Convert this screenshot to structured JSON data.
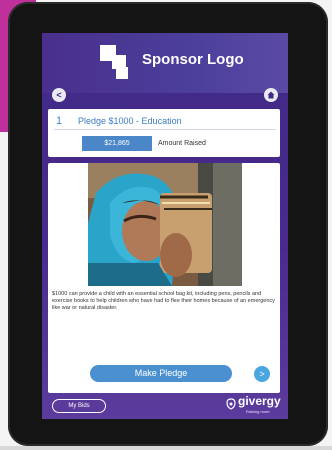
{
  "header": {
    "sponsor_logo_text": "Sponsor Logo"
  },
  "nav": {
    "back_icon": "chevron-left-icon",
    "home_icon": "home-icon"
  },
  "pledge_card": {
    "number": "1",
    "title": "Pledge $1000 - Education",
    "active_tab_label": "$21,865",
    "amount_raised_label": "Amount Raised"
  },
  "description": "$1000 can provide a child with an essential school bag kit, including pens, pencils and exercise books to help children who have had to flee their homes because of an emergency like war or natural disaster.",
  "actions": {
    "make_pledge_label": "Make Pledge",
    "next_icon": "chevron-right-icon"
  },
  "footer": {
    "my_bids_label": "My Bids",
    "brand": "givergy",
    "tagline": "Raising more"
  },
  "colors": {
    "screen_bg": "#3f2a86",
    "accent_blue": "#4a86c8",
    "magenta": "#c0309a"
  }
}
